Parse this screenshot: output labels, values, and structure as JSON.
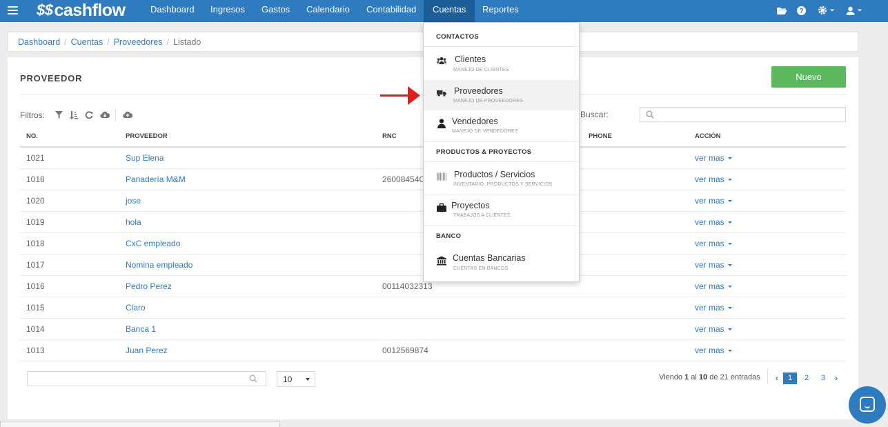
{
  "brand": "cashflow",
  "nav": {
    "items": [
      {
        "label": "Dashboard"
      },
      {
        "label": "Ingresos"
      },
      {
        "label": "Gastos"
      },
      {
        "label": "Calendario"
      },
      {
        "label": "Contabilidad"
      },
      {
        "label": "Cuentas"
      },
      {
        "label": "Reportes"
      }
    ],
    "active_label": "Cuentas",
    "right_icons": [
      "folder-open-icon",
      "help-icon",
      "gear-icon",
      "user-icon"
    ]
  },
  "breadcrumb": {
    "items": [
      "Dashboard",
      "Cuentas",
      "Proveedores"
    ],
    "current": "Listado"
  },
  "panel": {
    "title": "PROVEEDOR",
    "new_button": "Nuevo",
    "filters_label": "Filtros:",
    "search_label": "Buscar:"
  },
  "table": {
    "headers": {
      "no": "NO.",
      "proveedor": "PROVEEDOR",
      "rnc": "RNC",
      "phone": "PHONE",
      "accion": "ACCIÓN"
    },
    "rows": [
      {
        "no": "1021",
        "proveedor": "Sup Elena",
        "rnc": "",
        "phone": "",
        "action": "ver mas"
      },
      {
        "no": "1018",
        "proveedor": "Panadería M&M",
        "rnc": "26008454C",
        "phone": "",
        "action": "ver mas"
      },
      {
        "no": "1020",
        "proveedor": "jose",
        "rnc": "",
        "phone": "",
        "action": "ver mas"
      },
      {
        "no": "1019",
        "proveedor": "hola",
        "rnc": "",
        "phone": "",
        "action": "ver mas"
      },
      {
        "no": "1018",
        "proveedor": "CxC empleado",
        "rnc": "",
        "phone": "",
        "action": "ver mas"
      },
      {
        "no": "1017",
        "proveedor": "Nomina empleado",
        "rnc": "",
        "phone": "",
        "action": "ver mas"
      },
      {
        "no": "1016",
        "proveedor": "Pedro Perez",
        "rnc": "00114032313",
        "phone": "",
        "action": "ver mas"
      },
      {
        "no": "1015",
        "proveedor": "Claro",
        "rnc": "",
        "phone": "",
        "action": "ver mas"
      },
      {
        "no": "1014",
        "proveedor": "Banca 1",
        "rnc": "",
        "phone": "",
        "action": "ver mas"
      },
      {
        "no": "1013",
        "proveedor": "Juan Perez",
        "rnc": "0012569874",
        "phone": "",
        "action": "ver mas"
      }
    ]
  },
  "footer": {
    "page_size": "10",
    "info_prefix": "Viendo",
    "info_from": "1",
    "info_mid": "al",
    "info_to": "10",
    "info_de": "de",
    "info_total": "21",
    "info_suffix": "entradas",
    "pages": [
      "1",
      "2",
      "3"
    ],
    "current_page": "1"
  },
  "dropdown": {
    "sections": [
      {
        "header": "CONTACTOS",
        "items": [
          {
            "label": "Clientes",
            "sub": "MANEJO DE CLIENTES",
            "icon": "users-icon"
          },
          {
            "label": "Proveedores",
            "sub": "MANEJO DE PROVEEDORES",
            "icon": "truck-icon"
          },
          {
            "label": "Vendedores",
            "sub": "MANEJO DE VENDEDORES",
            "icon": "user-icon"
          }
        ]
      },
      {
        "header": "PRODUCTOS & PROYECTOS",
        "items": [
          {
            "label": "Productos / Servicios",
            "sub": "INVENTARIO, PRODUCTOS Y SERVICIOS",
            "icon": "barcode-icon"
          },
          {
            "label": "Proyectos",
            "sub": "TRABAJOS A CLIENTES",
            "icon": "briefcase-icon"
          }
        ]
      },
      {
        "header": "BANCO",
        "items": [
          {
            "label": "Cuentas Bancarias",
            "sub": "CUENTAS EN BANCOS",
            "icon": "bank-icon"
          }
        ]
      }
    ],
    "highlighted": "Proveedores"
  },
  "colors": {
    "nav_bg": "#2f7bbf",
    "nav_active": "#1d5e99",
    "link": "#337ab7",
    "new_button": "#5cb85c",
    "arrow": "#e31b1b"
  }
}
